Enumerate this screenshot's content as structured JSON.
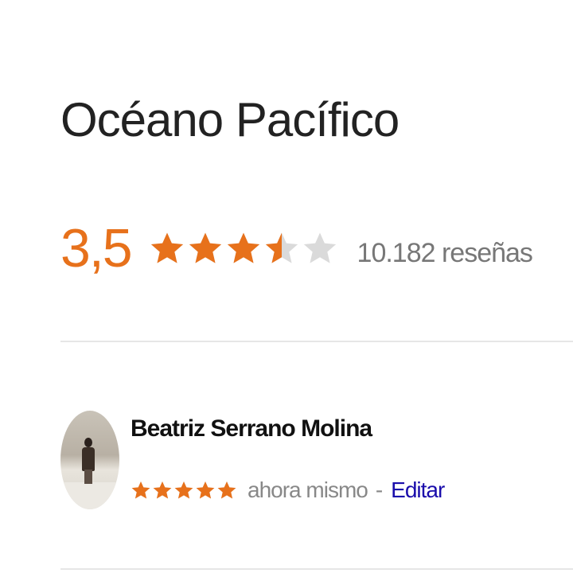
{
  "place": {
    "title": "Océano Pacífico"
  },
  "rating": {
    "value": "3,5",
    "value_numeric": 3.5,
    "max_stars": 5,
    "reviews_count": "10.182 reseñas"
  },
  "review": {
    "author": "Beatriz Serrano Molina",
    "stars": 5,
    "time": "ahora mismo",
    "separator": "-",
    "edit_label": "Editar"
  },
  "colors": {
    "star_filled": "#e7711b",
    "star_empty": "#dadada",
    "rating_value": "#e7711b",
    "link": "#1a0dab"
  },
  "icons": {
    "star": "star-icon",
    "avatar": "user-avatar-photo"
  }
}
